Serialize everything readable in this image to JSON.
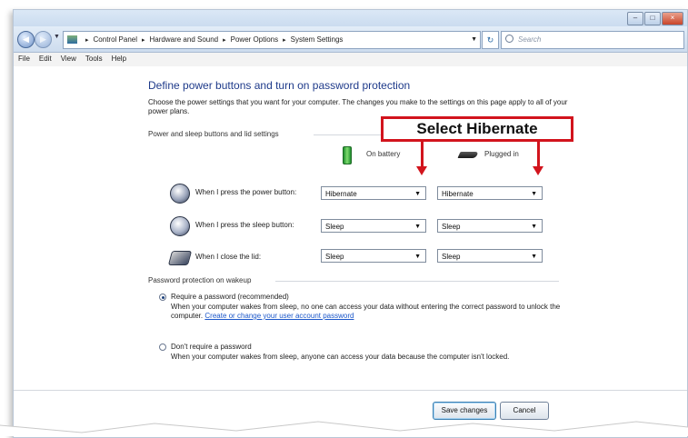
{
  "titlebar": {
    "caption_buttons": [
      "–",
      "□",
      "×"
    ]
  },
  "addressbar": {
    "breadcrumbs": [
      "Control Panel",
      "Hardware and Sound",
      "Power Options",
      "System Settings"
    ],
    "search_placeholder": "Search"
  },
  "menu": [
    "File",
    "Edit",
    "View",
    "Tools",
    "Help"
  ],
  "page": {
    "heading": "Define power buttons and turn on password protection",
    "description": "Choose the power settings that you want for your computer. The changes you make to the settings on this page apply to all of your power plans.",
    "section_power": "Power and sleep buttons and lid settings",
    "col_battery": "On battery",
    "col_plugged": "Plugged in",
    "rows": [
      {
        "label": "When I press the power button:",
        "battery": "Hibernate",
        "plugged": "Hibernate"
      },
      {
        "label": "When I press the sleep button:",
        "battery": "Sleep",
        "plugged": "Sleep"
      },
      {
        "label": "When I close the lid:",
        "battery": "Sleep",
        "plugged": "Sleep"
      }
    ],
    "section_password": "Password protection on wakeup",
    "require_label": "Require a password (recommended)",
    "require_text": "When your computer wakes from sleep, no one can access your data without entering the correct password to unlock the computer.",
    "require_link": "Create or change your user account password",
    "dont_label": "Don't require a password",
    "dont_text": "When your computer wakes from sleep, anyone can access your data because the computer isn't locked.",
    "selected_option": "require"
  },
  "buttons": {
    "save": "Save changes",
    "cancel": "Cancel"
  },
  "callout": {
    "text": "Select Hibernate"
  },
  "colors": {
    "callout_border": "#d2141d",
    "heading": "#1e3a8a",
    "link": "#1a56c9"
  }
}
